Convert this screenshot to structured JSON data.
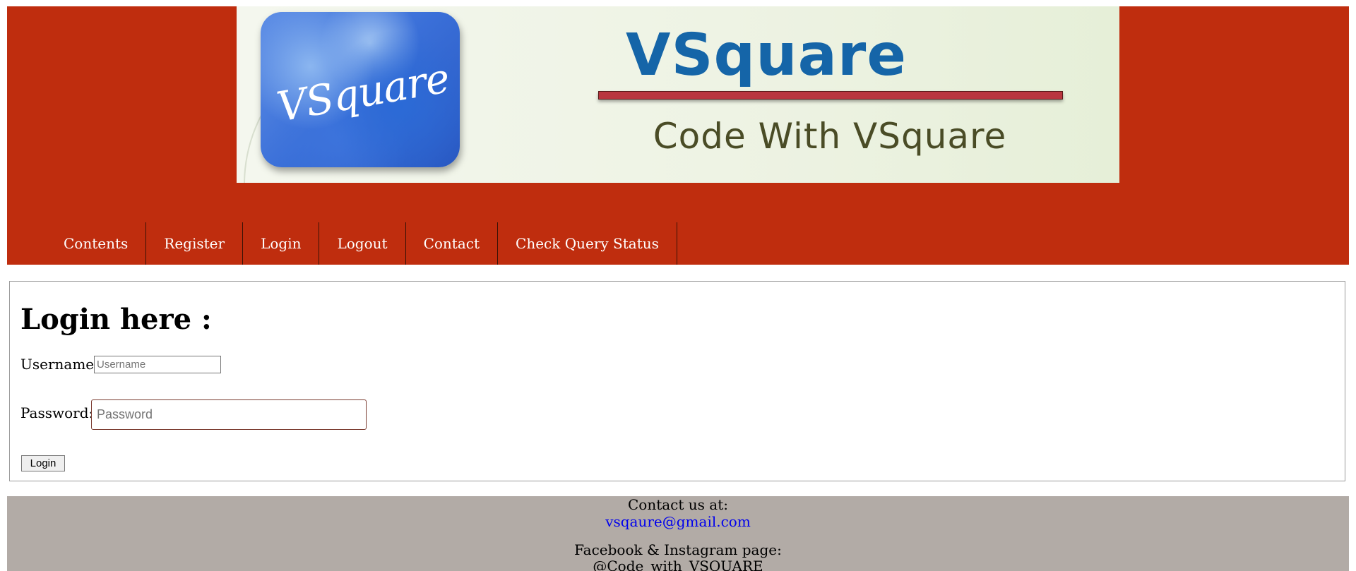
{
  "banner": {
    "logo_text": "VSquare",
    "title": "VSquare",
    "subtitle": "Code With VSquare"
  },
  "nav": {
    "items": [
      {
        "label": "Contents"
      },
      {
        "label": "Register"
      },
      {
        "label": "Login"
      },
      {
        "label": "Logout"
      },
      {
        "label": "Contact"
      },
      {
        "label": "Check Query Status"
      }
    ]
  },
  "login": {
    "heading": "Login here :",
    "username_label": "Username:",
    "username_value": "",
    "username_placeholder": "Username",
    "password_label": "Password:",
    "password_value": "",
    "password_placeholder": "Password",
    "submit_label": "Login"
  },
  "footer": {
    "contact_heading": "Contact us at:",
    "email": "vsqaure@gmail.com",
    "social_heading": "Facebook & Instagram page:",
    "social_handle": "@Code_with_VSQUARE"
  },
  "colors": {
    "header_bg": "#bf2d0e",
    "footer_bg": "#b2aba6",
    "link": "#0000ee",
    "banner_title": "#1565a8"
  }
}
